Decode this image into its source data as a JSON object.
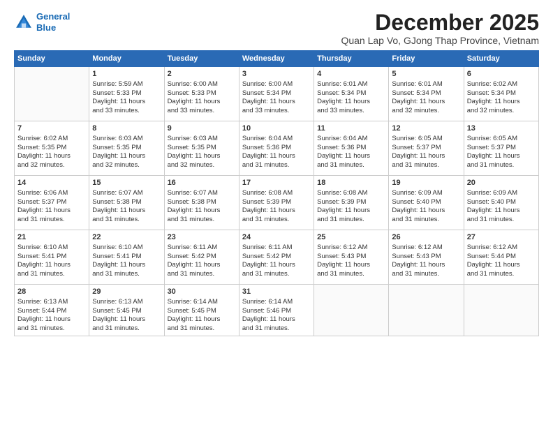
{
  "logo": {
    "line1": "General",
    "line2": "Blue"
  },
  "title": "December 2025",
  "subtitle": "Quan Lap Vo, GJong Thap Province, Vietnam",
  "days_of_week": [
    "Sunday",
    "Monday",
    "Tuesday",
    "Wednesday",
    "Thursday",
    "Friday",
    "Saturday"
  ],
  "weeks": [
    [
      {
        "day": "",
        "text": ""
      },
      {
        "day": "1",
        "text": "Sunrise: 5:59 AM\nSunset: 5:33 PM\nDaylight: 11 hours\nand 33 minutes."
      },
      {
        "day": "2",
        "text": "Sunrise: 6:00 AM\nSunset: 5:33 PM\nDaylight: 11 hours\nand 33 minutes."
      },
      {
        "day": "3",
        "text": "Sunrise: 6:00 AM\nSunset: 5:34 PM\nDaylight: 11 hours\nand 33 minutes."
      },
      {
        "day": "4",
        "text": "Sunrise: 6:01 AM\nSunset: 5:34 PM\nDaylight: 11 hours\nand 33 minutes."
      },
      {
        "day": "5",
        "text": "Sunrise: 6:01 AM\nSunset: 5:34 PM\nDaylight: 11 hours\nand 32 minutes."
      },
      {
        "day": "6",
        "text": "Sunrise: 6:02 AM\nSunset: 5:34 PM\nDaylight: 11 hours\nand 32 minutes."
      }
    ],
    [
      {
        "day": "7",
        "text": "Sunrise: 6:02 AM\nSunset: 5:35 PM\nDaylight: 11 hours\nand 32 minutes."
      },
      {
        "day": "8",
        "text": "Sunrise: 6:03 AM\nSunset: 5:35 PM\nDaylight: 11 hours\nand 32 minutes."
      },
      {
        "day": "9",
        "text": "Sunrise: 6:03 AM\nSunset: 5:35 PM\nDaylight: 11 hours\nand 32 minutes."
      },
      {
        "day": "10",
        "text": "Sunrise: 6:04 AM\nSunset: 5:36 PM\nDaylight: 11 hours\nand 31 minutes."
      },
      {
        "day": "11",
        "text": "Sunrise: 6:04 AM\nSunset: 5:36 PM\nDaylight: 11 hours\nand 31 minutes."
      },
      {
        "day": "12",
        "text": "Sunrise: 6:05 AM\nSunset: 5:37 PM\nDaylight: 11 hours\nand 31 minutes."
      },
      {
        "day": "13",
        "text": "Sunrise: 6:05 AM\nSunset: 5:37 PM\nDaylight: 11 hours\nand 31 minutes."
      }
    ],
    [
      {
        "day": "14",
        "text": "Sunrise: 6:06 AM\nSunset: 5:37 PM\nDaylight: 11 hours\nand 31 minutes."
      },
      {
        "day": "15",
        "text": "Sunrise: 6:07 AM\nSunset: 5:38 PM\nDaylight: 11 hours\nand 31 minutes."
      },
      {
        "day": "16",
        "text": "Sunrise: 6:07 AM\nSunset: 5:38 PM\nDaylight: 11 hours\nand 31 minutes."
      },
      {
        "day": "17",
        "text": "Sunrise: 6:08 AM\nSunset: 5:39 PM\nDaylight: 11 hours\nand 31 minutes."
      },
      {
        "day": "18",
        "text": "Sunrise: 6:08 AM\nSunset: 5:39 PM\nDaylight: 11 hours\nand 31 minutes."
      },
      {
        "day": "19",
        "text": "Sunrise: 6:09 AM\nSunset: 5:40 PM\nDaylight: 11 hours\nand 31 minutes."
      },
      {
        "day": "20",
        "text": "Sunrise: 6:09 AM\nSunset: 5:40 PM\nDaylight: 11 hours\nand 31 minutes."
      }
    ],
    [
      {
        "day": "21",
        "text": "Sunrise: 6:10 AM\nSunset: 5:41 PM\nDaylight: 11 hours\nand 31 minutes."
      },
      {
        "day": "22",
        "text": "Sunrise: 6:10 AM\nSunset: 5:41 PM\nDaylight: 11 hours\nand 31 minutes."
      },
      {
        "day": "23",
        "text": "Sunrise: 6:11 AM\nSunset: 5:42 PM\nDaylight: 11 hours\nand 31 minutes."
      },
      {
        "day": "24",
        "text": "Sunrise: 6:11 AM\nSunset: 5:42 PM\nDaylight: 11 hours\nand 31 minutes."
      },
      {
        "day": "25",
        "text": "Sunrise: 6:12 AM\nSunset: 5:43 PM\nDaylight: 11 hours\nand 31 minutes."
      },
      {
        "day": "26",
        "text": "Sunrise: 6:12 AM\nSunset: 5:43 PM\nDaylight: 11 hours\nand 31 minutes."
      },
      {
        "day": "27",
        "text": "Sunrise: 6:12 AM\nSunset: 5:44 PM\nDaylight: 11 hours\nand 31 minutes."
      }
    ],
    [
      {
        "day": "28",
        "text": "Sunrise: 6:13 AM\nSunset: 5:44 PM\nDaylight: 11 hours\nand 31 minutes."
      },
      {
        "day": "29",
        "text": "Sunrise: 6:13 AM\nSunset: 5:45 PM\nDaylight: 11 hours\nand 31 minutes."
      },
      {
        "day": "30",
        "text": "Sunrise: 6:14 AM\nSunset: 5:45 PM\nDaylight: 11 hours\nand 31 minutes."
      },
      {
        "day": "31",
        "text": "Sunrise: 6:14 AM\nSunset: 5:46 PM\nDaylight: 11 hours\nand 31 minutes."
      },
      {
        "day": "",
        "text": ""
      },
      {
        "day": "",
        "text": ""
      },
      {
        "day": "",
        "text": ""
      }
    ]
  ]
}
